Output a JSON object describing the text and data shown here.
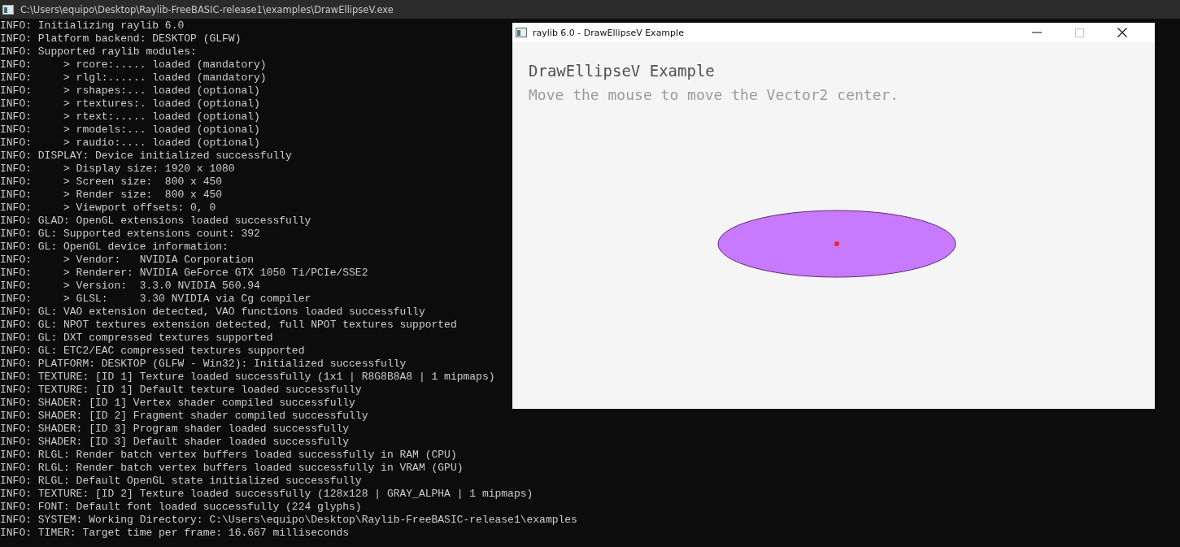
{
  "console": {
    "title": "C:\\Users\\equipo\\Desktop\\Raylib-FreeBASIC-release1\\examples\\DrawEllipseV.exe",
    "lines": [
      "INFO: Initializing raylib 6.0",
      "INFO: Platform backend: DESKTOP (GLFW)",
      "INFO: Supported raylib modules:",
      "INFO:     > rcore:..... loaded (mandatory)",
      "INFO:     > rlgl:...... loaded (mandatory)",
      "INFO:     > rshapes:... loaded (optional)",
      "INFO:     > rtextures:. loaded (optional)",
      "INFO:     > rtext:..... loaded (optional)",
      "INFO:     > rmodels:... loaded (optional)",
      "INFO:     > raudio:.... loaded (optional)",
      "INFO: DISPLAY: Device initialized successfully",
      "INFO:     > Display size: 1920 x 1080",
      "INFO:     > Screen size:  800 x 450",
      "INFO:     > Render size:  800 x 450",
      "INFO:     > Viewport offsets: 0, 0",
      "INFO: GLAD: OpenGL extensions loaded successfully",
      "INFO: GL: Supported extensions count: 392",
      "INFO: GL: OpenGL device information:",
      "INFO:     > Vendor:   NVIDIA Corporation",
      "INFO:     > Renderer: NVIDIA GeForce GTX 1050 Ti/PCIe/SSE2",
      "INFO:     > Version:  3.3.0 NVIDIA 560.94",
      "INFO:     > GLSL:     3.30 NVIDIA via Cg compiler",
      "INFO: GL: VAO extension detected, VAO functions loaded successfully",
      "INFO: GL: NPOT textures extension detected, full NPOT textures supported",
      "INFO: GL: DXT compressed textures supported",
      "INFO: GL: ETC2/EAC compressed textures supported",
      "INFO: PLATFORM: DESKTOP (GLFW - Win32): Initialized successfully",
      "INFO: TEXTURE: [ID 1] Texture loaded successfully (1x1 | R8G8B8A8 | 1 mipmaps)",
      "INFO: TEXTURE: [ID 1] Default texture loaded successfully",
      "INFO: SHADER: [ID 1] Vertex shader compiled successfully",
      "INFO: SHADER: [ID 2] Fragment shader compiled successfully",
      "INFO: SHADER: [ID 3] Program shader loaded successfully",
      "INFO: SHADER: [ID 3] Default shader loaded successfully",
      "INFO: RLGL: Render batch vertex buffers loaded successfully in RAM (CPU)",
      "INFO: RLGL: Render batch vertex buffers loaded successfully in VRAM (GPU)",
      "INFO: RLGL: Default OpenGL state initialized successfully",
      "INFO: TEXTURE: [ID 2] Texture loaded successfully (128x128 | GRAY_ALPHA | 1 mipmaps)",
      "INFO: FONT: Default font loaded successfully (224 glyphs)",
      "INFO: SYSTEM: Working Directory: C:\\Users\\equipo\\Desktop\\Raylib-FreeBASIC-release1\\examples",
      "INFO: TIMER: Target time per frame: 16.667 milliseconds"
    ]
  },
  "app_window": {
    "title": "raylib 6.0 - DrawEllipseV Example",
    "heading": "DrawEllipseV Example",
    "instruction": "Move the mouse to move the Vector2 center."
  }
}
